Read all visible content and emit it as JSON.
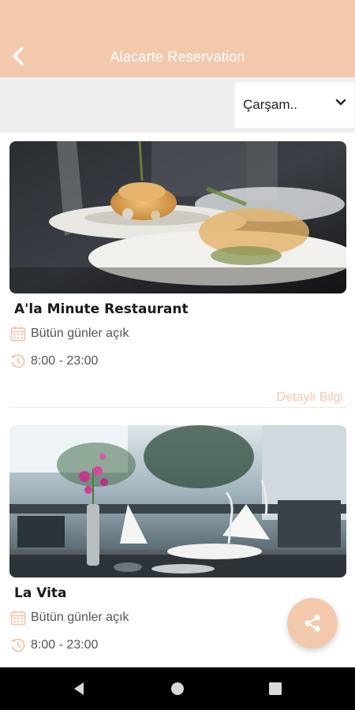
{
  "appbar": {
    "title": "Alacarte Reservation",
    "back_icon": "chevron-left-icon"
  },
  "filter": {
    "selected_day": "Çarşam..",
    "dropdown_icon": "chevron-down-icon"
  },
  "restaurants": [
    {
      "name": "A'la Minute Restaurant",
      "days": "Bütün günler açık",
      "hours": "8:00 - 23:00",
      "details_label": "Detaylı Bilgi"
    },
    {
      "name": "La Vita",
      "days": "Bütün günler açık",
      "hours": "8:00 - 23:00"
    }
  ],
  "fab": {
    "icon": "share-icon"
  },
  "colors": {
    "accent": "#f3c9ae",
    "filter_bg": "#efefef",
    "text_dark": "#1a1a1a",
    "text_muted": "#555555"
  }
}
